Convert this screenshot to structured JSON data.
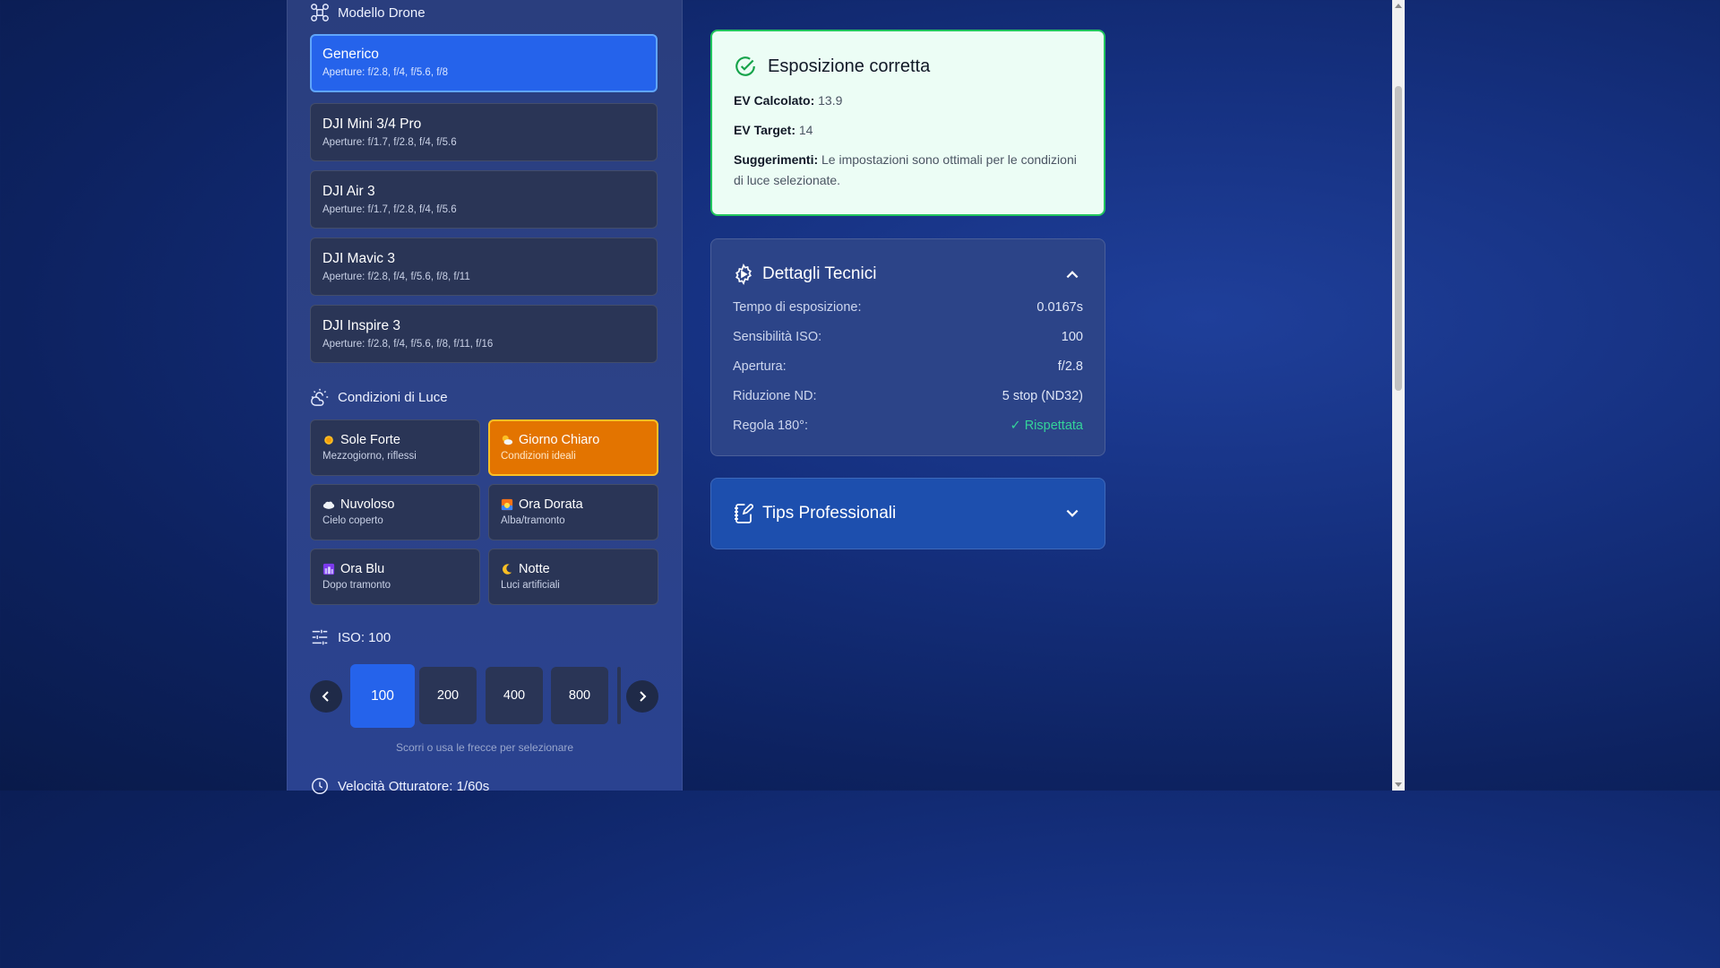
{
  "drone_section": {
    "title": "Modello Drone",
    "models": [
      {
        "name": "Generico",
        "apertures": "Aperture: f/2.8, f/4, f/5.6, f/8"
      },
      {
        "name": "DJI Mini 3/4 Pro",
        "apertures": "Aperture: f/1.7, f/2.8, f/4, f/5.6"
      },
      {
        "name": "DJI Air 3",
        "apertures": "Aperture: f/1.7, f/2.8, f/4, f/5.6"
      },
      {
        "name": "DJI Mavic 3",
        "apertures": "Aperture: f/2.8, f/4, f/5.6, f/8, f/11"
      },
      {
        "name": "DJI Inspire 3",
        "apertures": "Aperture: f/2.8, f/4, f/5.6, f/8, f/11, f/16"
      }
    ],
    "selected": "Generico"
  },
  "light_section": {
    "title": "Condizioni di Luce",
    "options": [
      {
        "name": "Sole Forte",
        "desc": "Mezzogiorno, riflessi",
        "icon": "sun-icon"
      },
      {
        "name": "Giorno Chiaro",
        "desc": "Condizioni ideali",
        "icon": "sun-cloud-icon"
      },
      {
        "name": "Nuvoloso",
        "desc": "Cielo coperto",
        "icon": "cloud-icon"
      },
      {
        "name": "Ora Dorata",
        "desc": "Alba/tramonto",
        "icon": "sunset-icon"
      },
      {
        "name": "Ora Blu",
        "desc": "Dopo tramonto",
        "icon": "night-city-icon"
      },
      {
        "name": "Notte",
        "desc": "Luci artificiali",
        "icon": "moon-icon"
      }
    ],
    "selected": "Giorno Chiaro"
  },
  "iso_section": {
    "title": "ISO: 100",
    "values": [
      "100",
      "200",
      "400",
      "800"
    ],
    "selected": "100",
    "hint": "Scorri o usa le frecce per selezionare"
  },
  "shutter_section": {
    "title": "Velocità Otturatore: 1/60s"
  },
  "exposure_result": {
    "title": "Esposizione corretta",
    "ev_calc_label": "EV Calcolato:",
    "ev_calc_value": "13.9",
    "ev_target_label": "EV Target:",
    "ev_target_value": "14",
    "suggestions_label": "Suggerimenti:",
    "suggestions_text": "Le impostazioni sono ottimali per le condizioni di luce selezionate.",
    "status_color": "#22c55e"
  },
  "technical_details": {
    "title": "Dettagli Tecnici",
    "rows": [
      {
        "label": "Tempo di esposizione:",
        "value": "0.0167s"
      },
      {
        "label": "Sensibilità ISO:",
        "value": "100"
      },
      {
        "label": "Apertura:",
        "value": "f/2.8"
      },
      {
        "label": "Riduzione ND:",
        "value": "5 stop (ND32)"
      },
      {
        "label": "Regola 180°:",
        "value": "✓ Rispettata"
      }
    ]
  },
  "pro_tips": {
    "title": "Tips Professionali"
  }
}
